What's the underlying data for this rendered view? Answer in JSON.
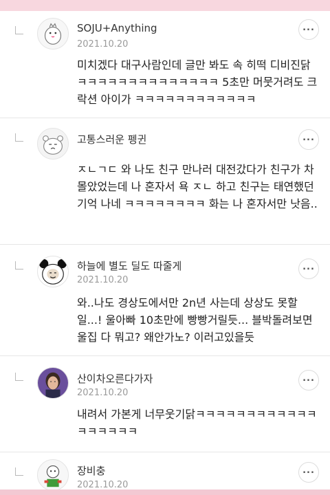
{
  "comments": [
    {
      "author": "SOJU+Anything",
      "date": "2021.10.20",
      "avatar_icon": "white-bird-mascot-icon",
      "body": "미치겠다 대구사람인데 글만 봐도 속 히떡 디비진닭ㅋㅋㅋㅋㅋㅋㅋㅋㅋㅋㅋㅋㅋㅋ 5초만 머뭇거려도 크락션 아이가 ㅋㅋㅋㅋㅋㅋㅋㅋㅋㅋㅋㅋ"
    },
    {
      "author": "고통스러운 펭귄",
      "date": "",
      "avatar_icon": "sad-cat-doodle-icon",
      "body": "ㅈㄴㄱㄷ 와 나도 친구 만나러 대전갔다가 친구가 차 몰았었는데 나 혼자서 욕 ㅈㄴ 하고 친구는 태연했던 기억 나네 ㅋㅋㅋㅋㅋㅋㅋㅋ 화는 나 혼자서만 낫음.."
    },
    {
      "author": "하늘에 별도 딜도 따줄게",
      "date": "2021.10.20",
      "avatar_icon": "panda-meme-face-icon",
      "body": "와..나도 경상도에서만 2n년 사는데 상상도 못할 일...! 울아빠 10초만에 빵빵거릴듯... 블박돌려보면 울집 다 뭐고? 왜안가노? 이러고있을듯"
    },
    {
      "author": "산이차오른다가자",
      "date": "2021.10.20",
      "avatar_icon": "person-photo-icon",
      "body": "내려서 가본게 너무웃기닭ㅋㅋㅋㅋㅋㅋㅋㅋㅋㅋㅋㅋㅋㅋㅋㅋㅋㅋ"
    },
    {
      "author": "장비충",
      "date": "2021.10.20",
      "avatar_icon": "cartoon-character-icon",
      "body": ""
    }
  ],
  "more_button_icon": "more-dots-icon",
  "reply_marker_icon": "reply-indent-icon",
  "colors": {
    "top_band": "#f8d7df",
    "date": "#9a9a9a",
    "divider": "#e6e6e6"
  }
}
